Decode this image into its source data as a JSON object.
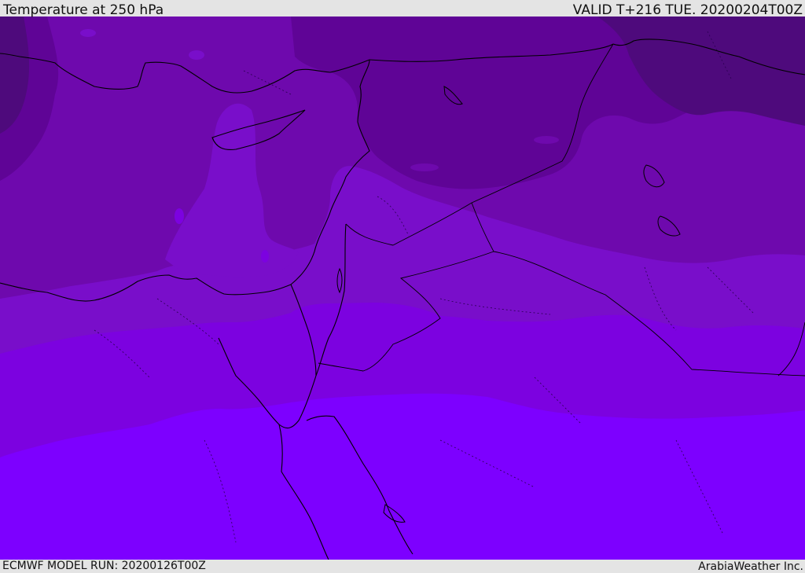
{
  "header": {
    "title": "Temperature at 250 hPa",
    "valid_time": "VALID T+216 TUE. 20200204T00Z"
  },
  "footer": {
    "model_run": "ECMWF MODEL RUN: 20200126T00Z",
    "credit": "ArabiaWeather Inc."
  },
  "map": {
    "variable": "temperature",
    "pressure_level": "250 hPa",
    "colors": {
      "band_coldest": "#4e0a7c",
      "band_2": "#5f0496",
      "band_3": "#6e09ad",
      "band_4": "#790eca",
      "band_5": "#7c02e0",
      "band_warmest": "#7d00ff",
      "coastline": "#000000"
    }
  }
}
